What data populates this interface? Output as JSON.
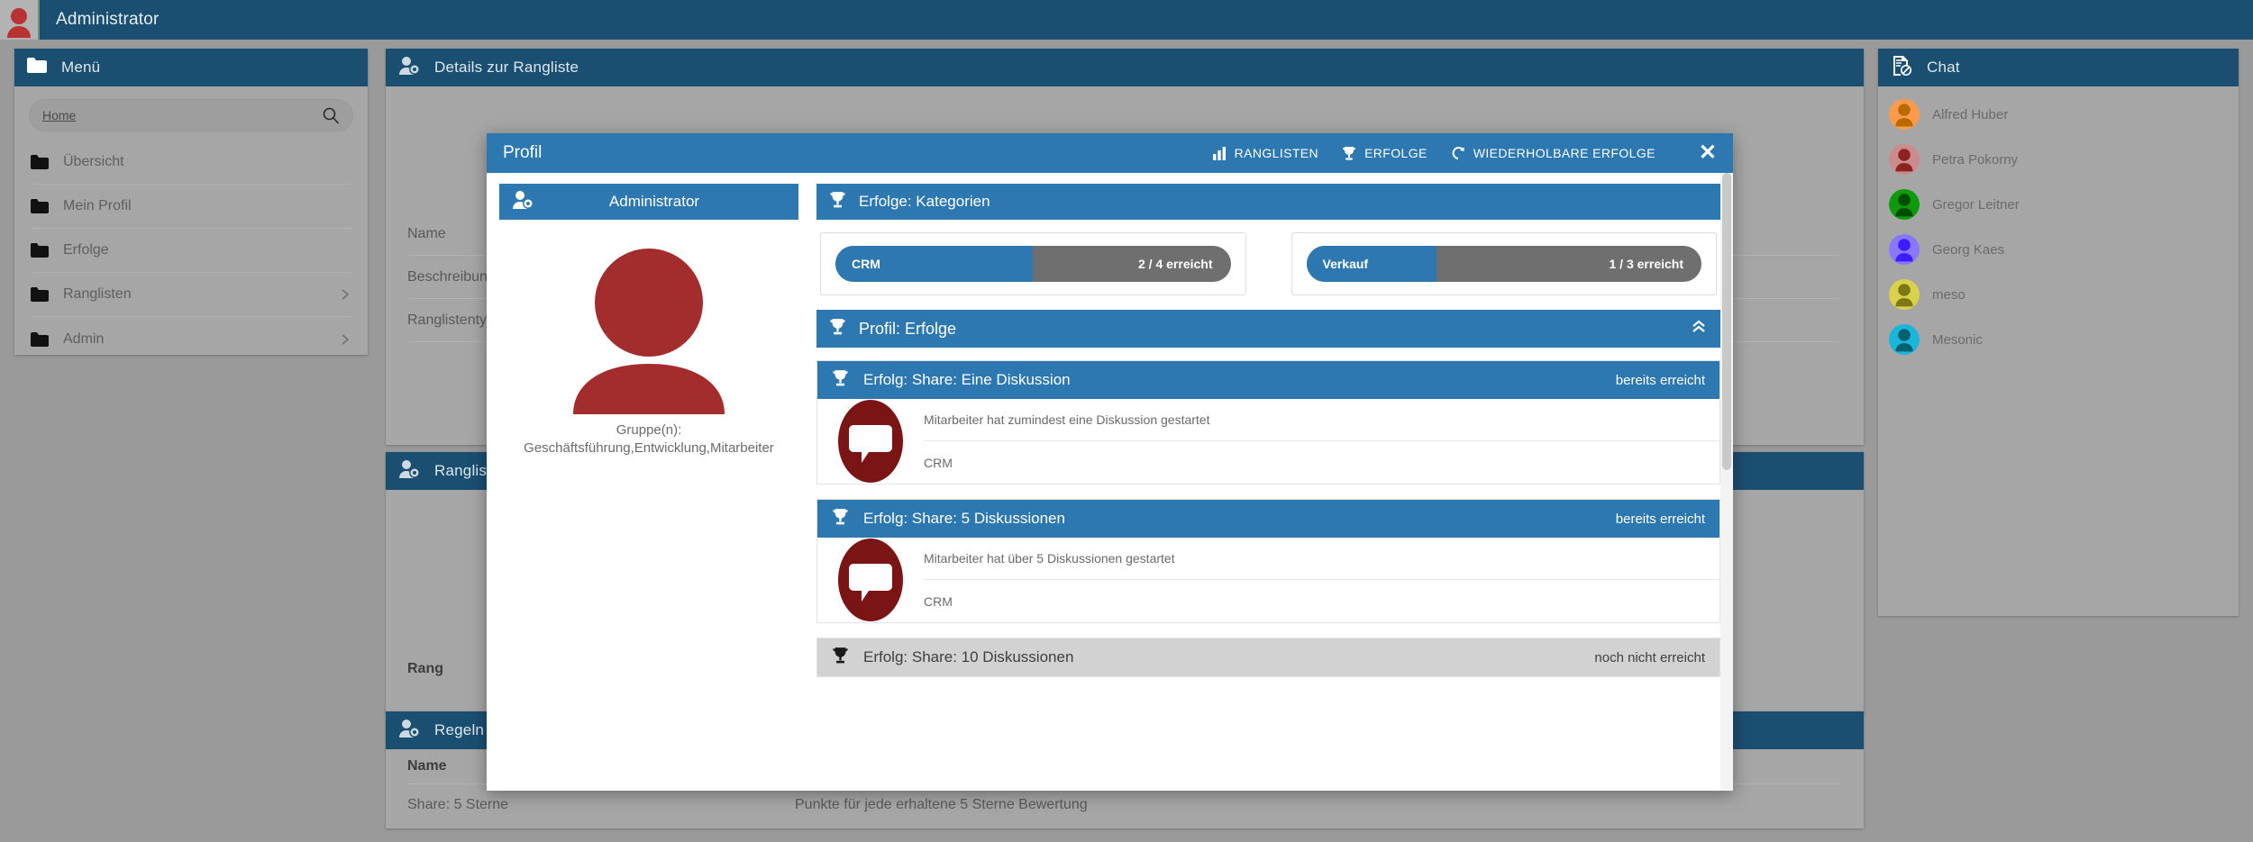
{
  "topbar": {
    "title": "Administrator",
    "avatar_icon": "user-avatar-icon"
  },
  "sidebar": {
    "title": "Menü",
    "header_icon": "folder-icon",
    "search": {
      "value": "Home",
      "placeholder": "Home",
      "icon": "search-icon"
    },
    "items": [
      {
        "label": "Übersicht",
        "icon": "folder-icon",
        "expandable": false
      },
      {
        "label": "Mein Profil",
        "icon": "folder-icon",
        "expandable": false
      },
      {
        "label": "Erfolge",
        "icon": "folder-icon",
        "expandable": false
      },
      {
        "label": "Ranglisten",
        "icon": "folder-icon",
        "expandable": true
      },
      {
        "label": "Admin",
        "icon": "folder-icon",
        "expandable": true
      }
    ]
  },
  "details_panel": {
    "title": "Details zur Rangliste",
    "header_icon": "user-details-icon",
    "rows": [
      {
        "label": "Name",
        "value": ""
      },
      {
        "label": "Beschreibung",
        "value": ""
      },
      {
        "label": "Ranglistentyp",
        "value": ""
      }
    ]
  },
  "rangliste_panel": {
    "title": "Rangliste",
    "header_icon": "user-details-icon",
    "column_header": "Rang"
  },
  "regeln_panel": {
    "title": "Regeln",
    "header_icon": "user-details-icon",
    "columns": [
      "Name",
      ""
    ],
    "rows": [
      {
        "name": "Share: 5 Sterne",
        "description": "Punkte für jede erhaltene 5 Sterne Bewertung"
      }
    ]
  },
  "chat": {
    "title": "Chat",
    "header_icon": "chat-document-icon",
    "contacts": [
      {
        "name": "Alfred Huber",
        "color": "#ff9a4d",
        "fg": "#b86a00"
      },
      {
        "name": "Petra Pokorny",
        "color": "#cc8b8b",
        "fg": "#8c2222"
      },
      {
        "name": "Gregor Leitner",
        "color": "#0d9b0d",
        "fg": "#004d00"
      },
      {
        "name": "Georg Kaes",
        "color": "#8877ff",
        "fg": "#3f1bff"
      },
      {
        "name": "meso",
        "color": "#d9d14a",
        "fg": "#7d7717"
      },
      {
        "name": "Mesonic",
        "color": "#1ab5da",
        "fg": "#00616f"
      }
    ]
  },
  "modal": {
    "title": "Profil",
    "close_icon": "close-icon",
    "actions": [
      {
        "label": "RANGLISTEN",
        "icon": "bar-chart-icon"
      },
      {
        "label": "ERFOLGE",
        "icon": "trophy-icon"
      },
      {
        "label": "WIEDERHOLBARE ERFOLGE",
        "icon": "refresh-icon"
      }
    ],
    "profile": {
      "header_title": "Administrator",
      "header_icon": "user-details-icon",
      "avatar_icon": "user-avatar-icon",
      "groups_label": "Gruppe(n):",
      "groups_value": "Geschäftsführung,Entwicklung,Mitarbeiter"
    },
    "categories": {
      "title": "Erfolge: Kategorien",
      "icon": "trophy-icon",
      "items": [
        {
          "label": "CRM",
          "value_text": "2 / 4 erreicht",
          "current": 2,
          "total": 4,
          "percent": 50
        },
        {
          "label": "Verkauf",
          "value_text": "1 / 3 erreicht",
          "current": 1,
          "total": 3,
          "percent": 33
        }
      ]
    },
    "achievements_section": {
      "title": "Profil: Erfolge",
      "icon": "trophy-icon",
      "collapse_icon": "chevron-double-up-icon"
    },
    "achievements": [
      {
        "title": "Erfolg: Share: Eine Diskussion",
        "status": "bereits erreicht",
        "achieved": true,
        "icon": "speech-bubble-icon",
        "description": "Mitarbeiter hat zumindest eine Diskussion gestartet",
        "category": "CRM"
      },
      {
        "title": "Erfolg: Share: 5 Diskussionen",
        "status": "bereits erreicht",
        "achieved": true,
        "icon": "speech-bubble-icon",
        "description": "Mitarbeiter hat über 5 Diskussionen gestartet",
        "category": "CRM"
      },
      {
        "title": "Erfolg: Share: 10 Diskussionen",
        "status": "noch nicht erreicht",
        "achieved": false,
        "icon": "trophy-icon",
        "description": "",
        "category": ""
      }
    ]
  },
  "colors": {
    "header_blue": "#1b4f72",
    "accent_blue": "#2d78b0",
    "avatar_red": "#a32c2c",
    "progress_track": "#6f6f6f",
    "page_bg": "#9a9a9a",
    "panel_bg": "#a6a6a6"
  }
}
